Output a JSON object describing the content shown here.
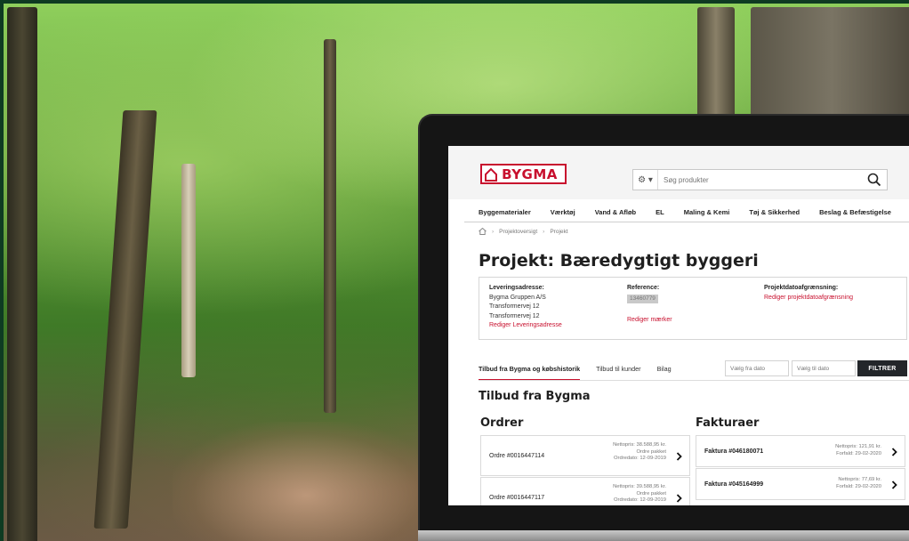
{
  "logo": {
    "text": "BYGMA"
  },
  "search": {
    "placeholder": "Søg produkter",
    "settings_label": "⚙ ▾"
  },
  "nav": {
    "items": [
      "Byggematerialer",
      "Værktøj",
      "Vand & Afløb",
      "EL",
      "Maling & Kemi",
      "Tøj & Sikkerhed",
      "Beslag & Befæstigelse"
    ]
  },
  "breadcrumb": {
    "items": [
      "Projektoversigt",
      "Projekt"
    ]
  },
  "page": {
    "title": "Projekt: Bæredygtigt byggeri"
  },
  "info": {
    "delivery_label": "Leveringsadresse:",
    "delivery_lines": [
      "Bygma Gruppen A/S",
      "Transformervej 12",
      "Transformervej 12"
    ],
    "delivery_edit": "Rediger Leveringsadresse",
    "reference_label": "Reference:",
    "reference_value": "13460779",
    "reference_edit": "Rediger mærker",
    "date_label": "Projektdatoafgrænsning:",
    "date_edit": "Rediger projektdatoafgrænsning"
  },
  "tabs": [
    {
      "label": "Tilbud fra Bygma og købshistorik",
      "active": true
    },
    {
      "label": "Tilbud til kunder",
      "active": false
    },
    {
      "label": "Bilag",
      "active": false
    }
  ],
  "filter": {
    "from_placeholder": "Vælg fra dato",
    "to_placeholder": "Vælg til dato",
    "button_label": "FILTRER"
  },
  "section_title": "Tilbud fra Bygma",
  "orders": {
    "title": "Ordrer",
    "items": [
      {
        "name": "Ordre #0016447114",
        "meta": [
          "Nettopris: 38.588,95 kr.",
          "Ordre pakket",
          "Ordredato: 12-09-2019"
        ]
      },
      {
        "name": "Ordre #0016447117",
        "meta": [
          "Nettopris: 39.588,95 kr.",
          "Ordre pakket",
          "Ordredato: 12-09-2019"
        ]
      }
    ]
  },
  "invoices": {
    "title": "Fakturaer",
    "items": [
      {
        "name": "Faktura #046180071",
        "meta": [
          "Nettopris: 121,91 kr.",
          "Forfald: 29-02-2020"
        ]
      },
      {
        "name": "Faktura #045164999",
        "meta": [
          "Nettopris: 77,69 kr.",
          "Forfald: 29-02-2020"
        ]
      }
    ]
  },
  "colors": {
    "brand": "#c8102e",
    "dark_button": "#23262a"
  }
}
